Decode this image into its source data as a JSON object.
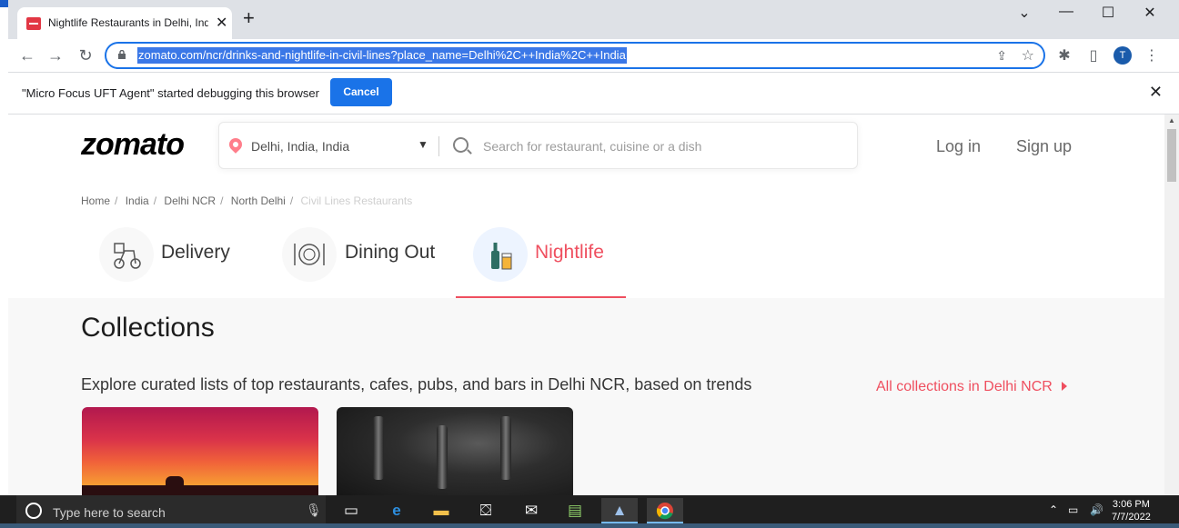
{
  "browser": {
    "tab_title": "Nightlife Restaurants in Delhi, India",
    "url": "zomato.com/ncr/drinks-and-nightlife-in-civil-lines?place_name=Delhi%2C++India%2C++India",
    "avatar_letter": "T"
  },
  "infobar": {
    "message": "\"Micro Focus UFT Agent\" started debugging this browser",
    "cancel_label": "Cancel"
  },
  "site": {
    "logo": "zomato",
    "location": "Delhi, India, India",
    "search_placeholder": "Search for restaurant, cuisine or a dish",
    "login": "Log in",
    "signup": "Sign up",
    "breadcrumbs": [
      "Home",
      "India",
      "Delhi NCR",
      "North Delhi",
      "Civil Lines Restaurants"
    ],
    "tabs": [
      {
        "label": "Delivery",
        "active": false
      },
      {
        "label": "Dining Out",
        "active": false
      },
      {
        "label": "Nightlife",
        "active": true
      }
    ],
    "collections_title": "Collections",
    "collections_subtitle": "Explore curated lists of top restaurants, cafes, pubs, and bars in Delhi NCR, based on trends",
    "all_collections": "All collections in Delhi NCR"
  },
  "taskbar": {
    "search_placeholder": "Type here to search",
    "time": "3:06 PM",
    "date": "7/7/2022"
  },
  "colors": {
    "brand": "#e23744",
    "accent_link": "#ef4f5f",
    "chrome_blue": "#1a73e8"
  }
}
